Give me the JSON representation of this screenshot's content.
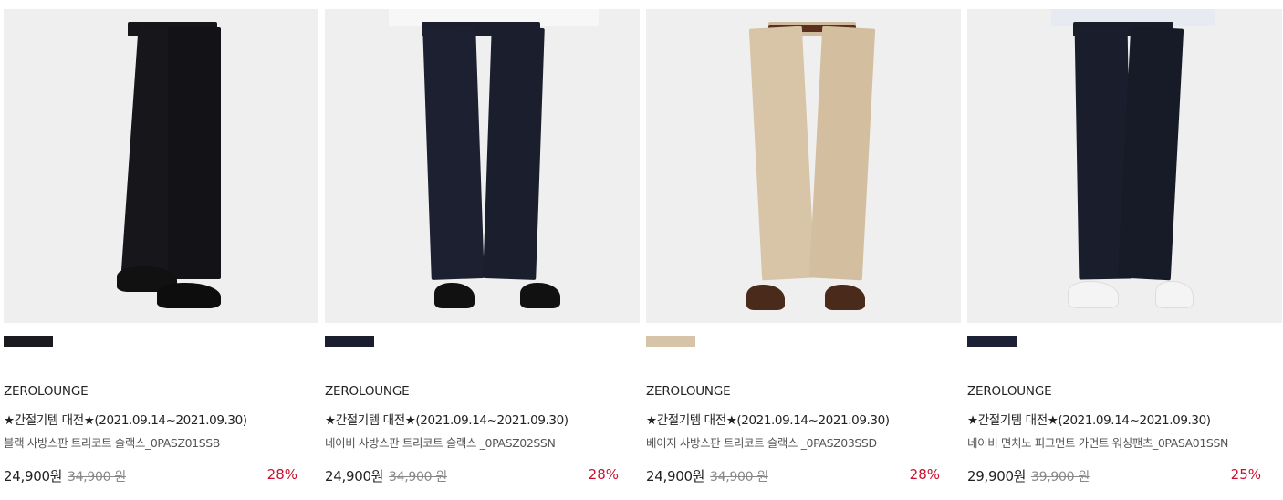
{
  "products": [
    {
      "brand": "ZEROLOUNGE",
      "promo": "★간절기템 대전★(2021.09.14~2021.09.30)",
      "name": "블랙 사방스판 트리코트 슬랙스_0PASZ01SSB",
      "sale_price": "24,900원",
      "original_price": "34,900 원",
      "discount": "28%",
      "swatch_color": "#1b1b1f",
      "pants_color": "#17171b",
      "shoe_color": "#111111"
    },
    {
      "brand": "ZEROLOUNGE",
      "promo": "★간절기템 대전★(2021.09.14~2021.09.30)",
      "name": "네이비 사방스판 트리코트 슬랙스 _0PASZ02SSN",
      "sale_price": "24,900원",
      "original_price": "34,900 원",
      "discount": "28%",
      "swatch_color": "#1a1e2e",
      "pants_color": "#1c2030",
      "shoe_color": "#111111"
    },
    {
      "brand": "ZEROLOUNGE",
      "promo": "★간절기템 대전★(2021.09.14~2021.09.30)",
      "name": "베이지 사방스판 트리코트 슬랙스 _0PASZ03SSD",
      "sale_price": "24,900원",
      "original_price": "34,900 원",
      "discount": "28%",
      "swatch_color": "#d6c3a8",
      "pants_color": "#d8c4a6",
      "shoe_color": "#4a2a1a"
    },
    {
      "brand": "ZEROLOUNGE",
      "promo": "★간절기템 대전★(2021.09.14~2021.09.30)",
      "name": "네이비 면치노 피그먼트 가먼트 워싱팬츠_0PASA01SSN",
      "sale_price": "29,900원",
      "original_price": "39,900 원",
      "discount": "25%",
      "swatch_color": "#1c2135",
      "pants_color": "#1a1e2c",
      "shoe_color": "#f4f4f4"
    }
  ]
}
